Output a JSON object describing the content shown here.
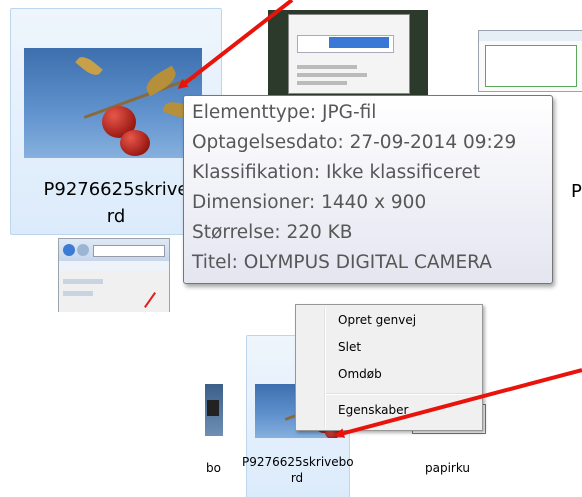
{
  "top_view": {
    "file_name_line1": "P9276625skrive",
    "file_name_line2": "rd",
    "right_partial_label": "P",
    "tooltip": {
      "lines": [
        "Elementtype: JPG-fil",
        "Optagelsesdato: 27-09-2014 09:29",
        "Klassifikation: Ikke klassificeret",
        "Dimensioner: 1440 x 900",
        "Størrelse: 220 KB",
        "Titel: OLYMPUS DIGITAL CAMERA"
      ]
    }
  },
  "bottom_view": {
    "left_partial_label": "bo",
    "file_name_line1": "P9276625skrivebo",
    "file_name_line2": "rd",
    "right_partial_label": "papirku",
    "context_menu": {
      "items": [
        "Opret genvej",
        "Slet",
        "Omdøb",
        "Egenskaber"
      ]
    }
  },
  "colors": {
    "arrow": "#e8140c",
    "selection": "#dcebfb",
    "tooltip_text": "#575757"
  }
}
